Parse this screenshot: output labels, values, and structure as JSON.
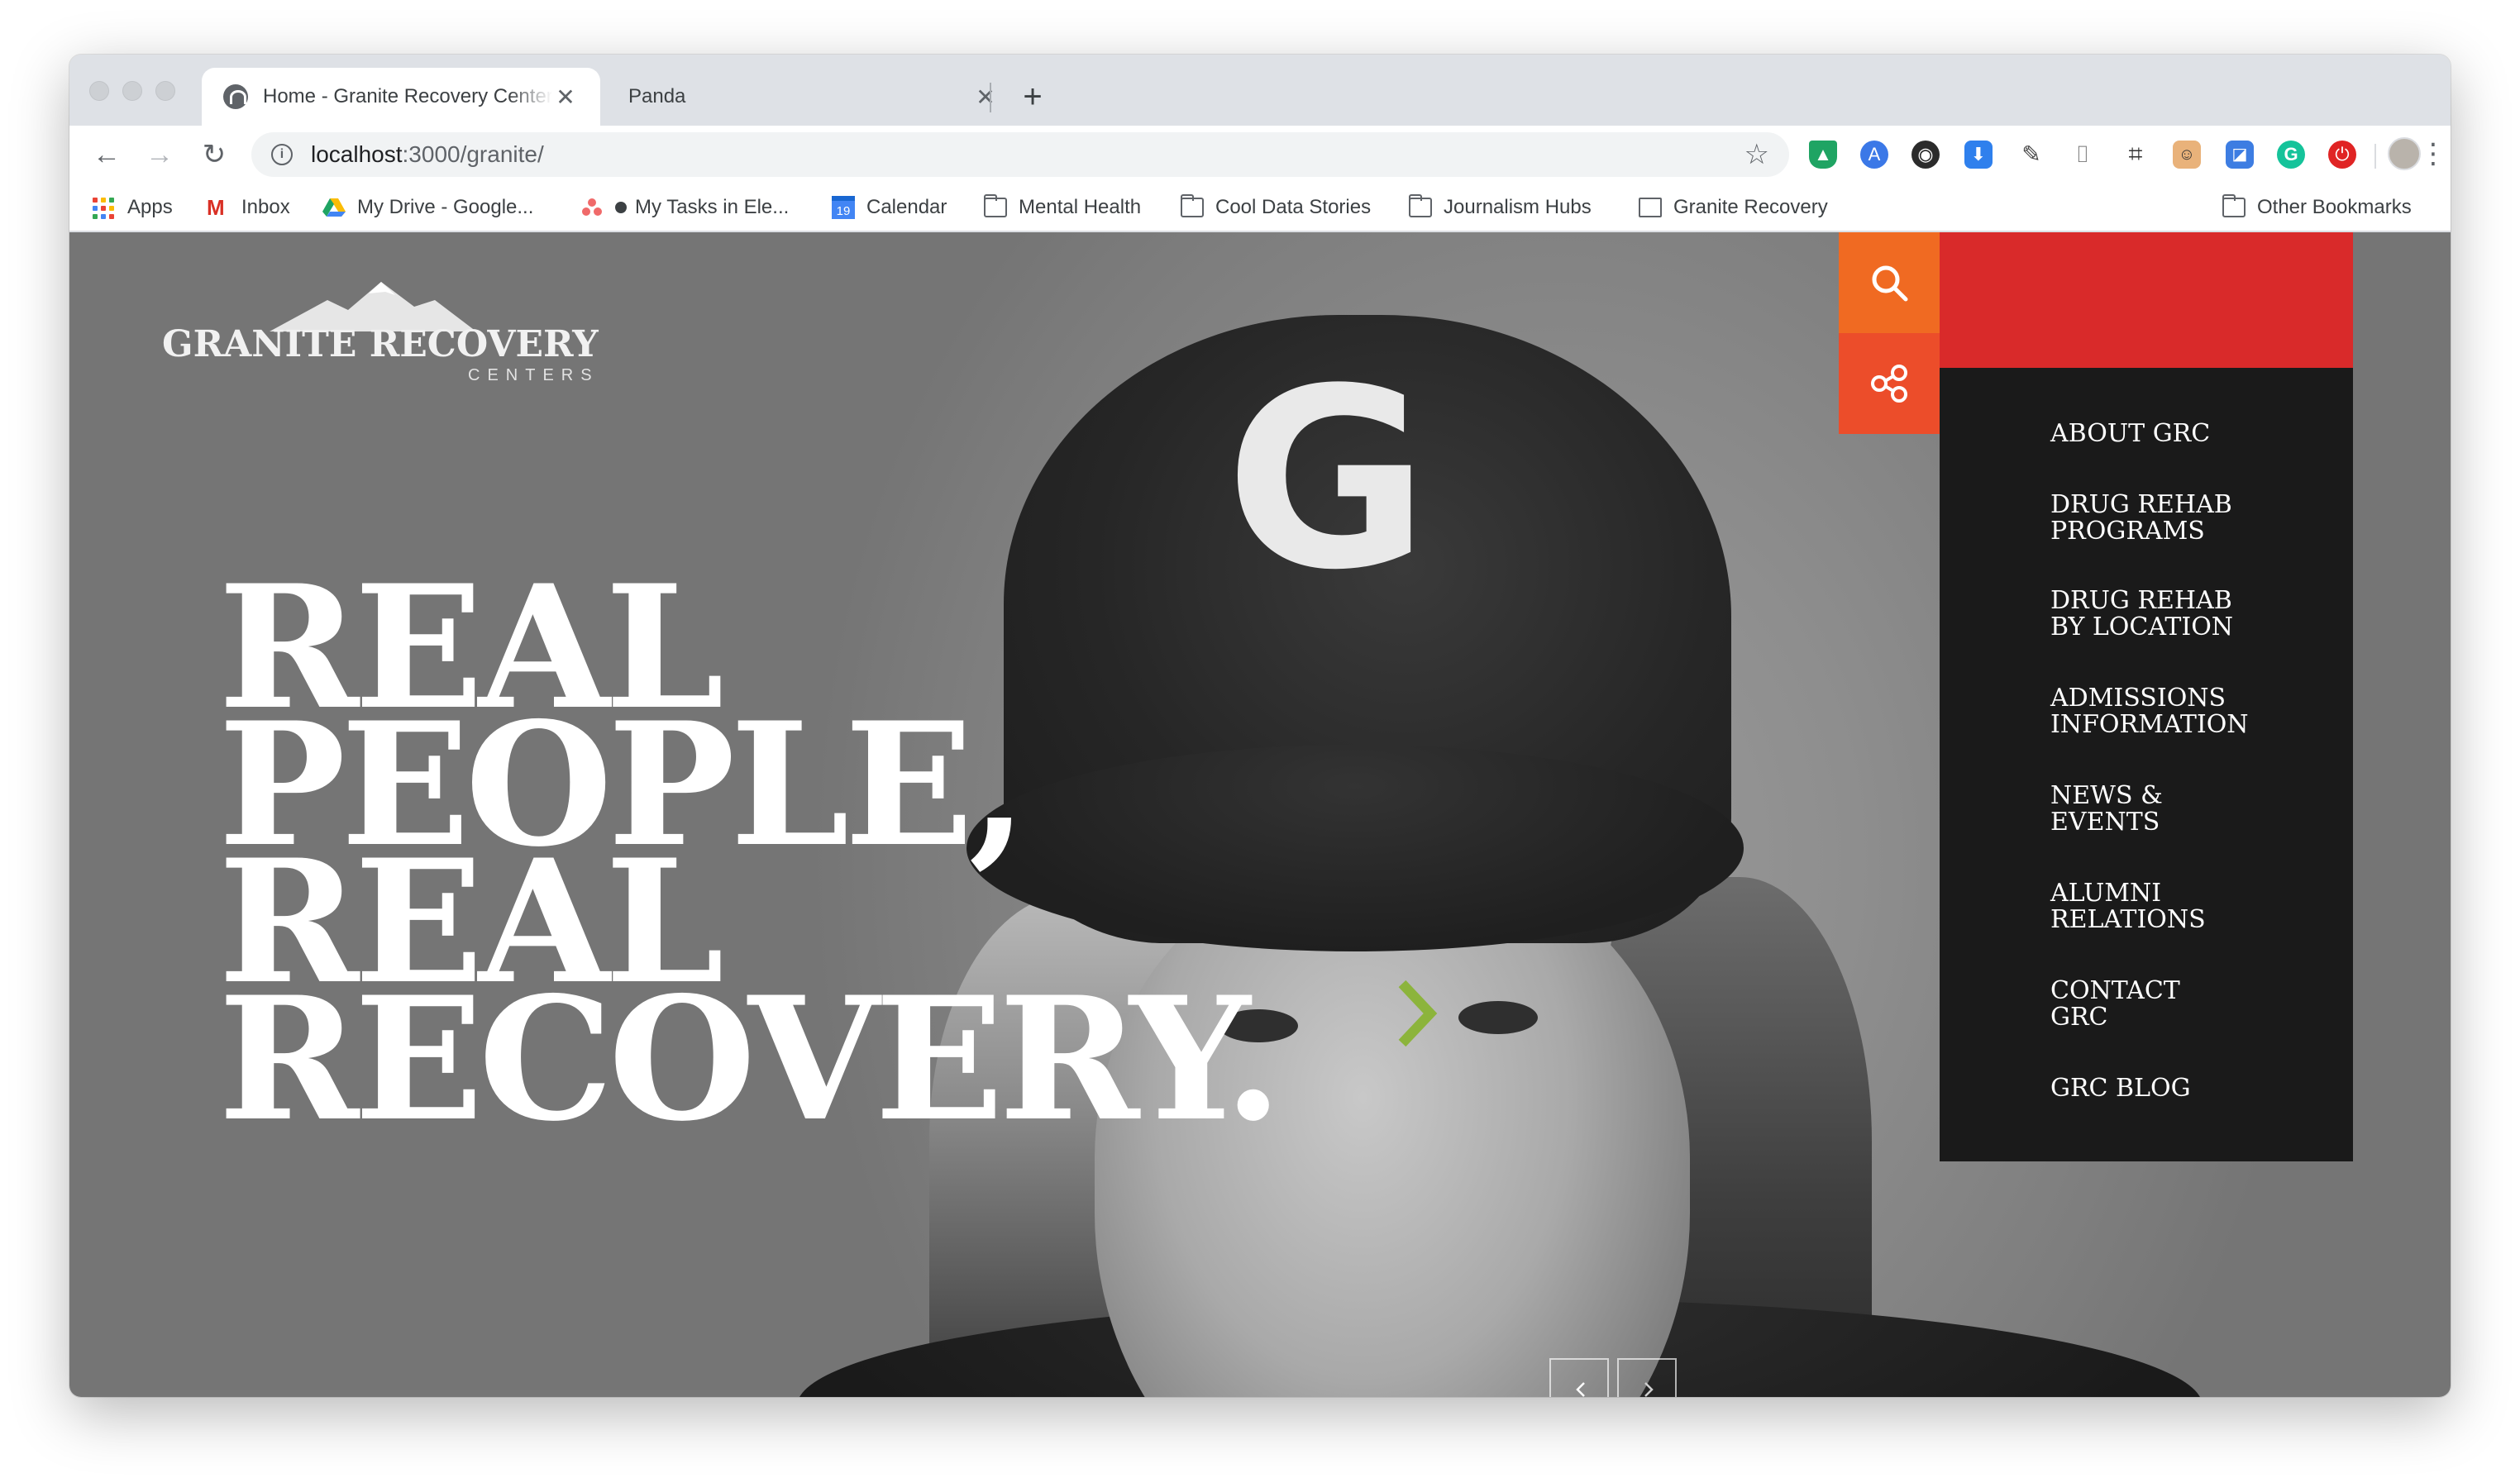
{
  "browser": {
    "tabs": [
      {
        "title": "Home - Granite Recovery Centers",
        "active": true
      },
      {
        "title": "Panda",
        "active": false
      }
    ],
    "url_host": "localhost",
    "url_rest": ":3000/granite/",
    "bookmarks": [
      {
        "label": "Apps",
        "icon": "apps-grid-icon"
      },
      {
        "label": "Inbox",
        "icon": "gmail-icon"
      },
      {
        "label": "My Drive - Google...",
        "icon": "google-drive-icon"
      },
      {
        "label": "My Tasks in Ele...",
        "icon": "asana-icon"
      },
      {
        "label": "Calendar",
        "icon": "calendar-icon"
      },
      {
        "label": "Mental Health",
        "icon": "folder-icon"
      },
      {
        "label": "Cool Data Stories",
        "icon": "folder-icon"
      },
      {
        "label": "Journalism Hubs",
        "icon": "folder-icon"
      },
      {
        "label": "Granite Recovery",
        "icon": "page-icon"
      }
    ],
    "other_bookmarks": "Other Bookmarks",
    "calendar_day": "19"
  },
  "site": {
    "logo": {
      "word_1": "GRANITE",
      "word_2": "RECOVERY",
      "sub": "CENTERS"
    },
    "headline": [
      "REAL",
      "PEOPLE,",
      "REAL",
      "RECOVERY."
    ],
    "cap_letter": "G",
    "menu": [
      [
        "ABOUT GRC"
      ],
      [
        "DRUG REHAB",
        "PROGRAMS"
      ],
      [
        "DRUG REHAB",
        "BY LOCATION"
      ],
      [
        "ADMISSIONS",
        "INFORMATION"
      ],
      [
        "NEWS &",
        "EVENTS"
      ],
      [
        "ALUMNI",
        "RELATIONS"
      ],
      [
        "CONTACT",
        "GRC"
      ],
      [
        "GRC BLOG"
      ]
    ]
  },
  "colors": {
    "search_orange": "#f06a22",
    "share_orange": "#ec4d2a",
    "red_bar": "#d92a2a",
    "menu_bg": "#1a1a1a",
    "chevron_green": "#8cb43c"
  }
}
